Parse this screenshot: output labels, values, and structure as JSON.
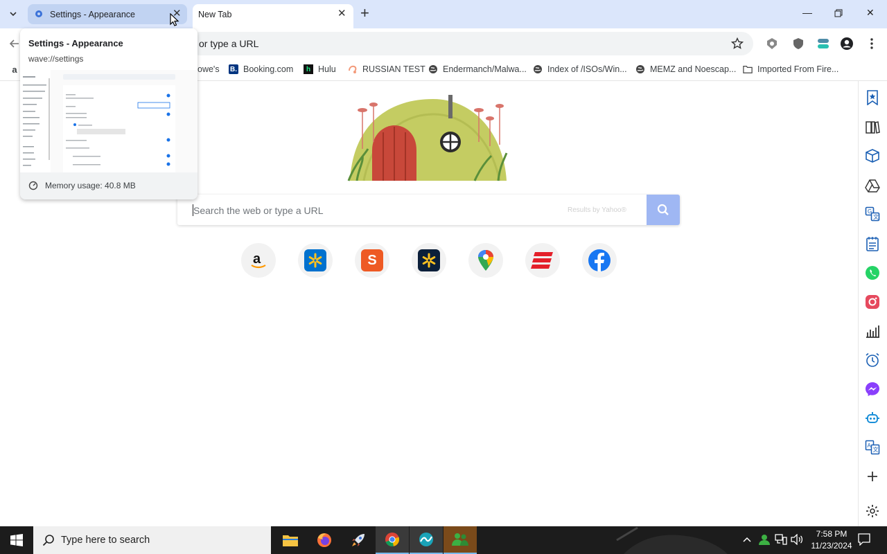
{
  "tabs": [
    {
      "title": "Settings - Appearance",
      "active": false
    },
    {
      "title": "New Tab",
      "active": true
    }
  ],
  "hover_card": {
    "title": "Settings - Appearance",
    "url": "wave://settings",
    "memory": "Memory usage: 40.8 MB"
  },
  "omnibox": {
    "text": "or type a URL"
  },
  "bookmarks": [
    {
      "label": "owe's"
    },
    {
      "label": "Booking.com"
    },
    {
      "label": "Hulu"
    },
    {
      "label": "RUSSIAN TEST"
    },
    {
      "label": "Endermanch/Malwa..."
    },
    {
      "label": "Index of /ISOs/Win..."
    },
    {
      "label": "MEMZ and Noescap..."
    },
    {
      "label": "Imported From Fire..."
    }
  ],
  "search": {
    "placeholder": "Search the web or type a URL",
    "provider_note": "Results by Yahoo®"
  },
  "shortcuts": [
    {
      "name": "Amazon",
      "color": "#232f3e"
    },
    {
      "name": "Walmart",
      "color": "#0071ce"
    },
    {
      "name": "S",
      "color": "#ee5a24"
    },
    {
      "name": "Walmart",
      "color": "#0b1f3a"
    },
    {
      "name": "Google Maps",
      "color": "#34a853"
    },
    {
      "name": "E",
      "color": "#e4202a"
    },
    {
      "name": "Facebook",
      "color": "#1877f2"
    }
  ],
  "taskbar": {
    "search_placeholder": "Type here to search",
    "time": "7:58 PM",
    "date": "11/23/2024"
  },
  "colors": {
    "tabstrip": "#dbe6fb",
    "accent": "#9fb7f3"
  }
}
